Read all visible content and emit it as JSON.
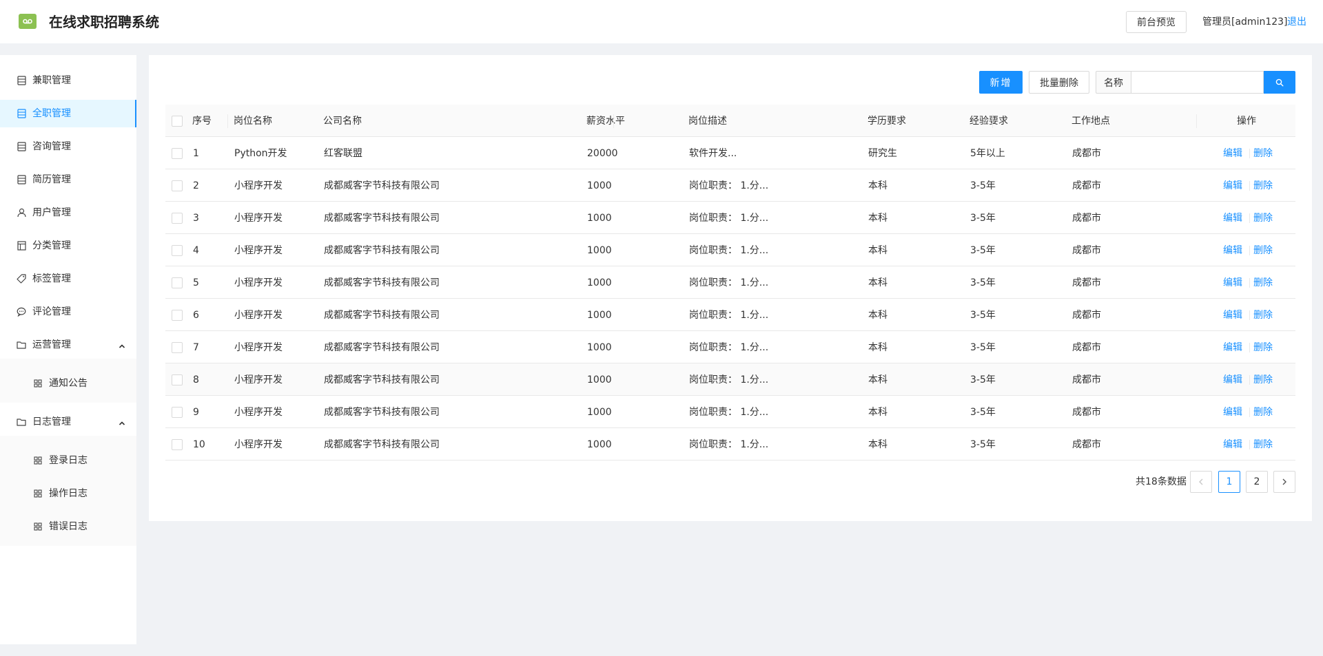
{
  "header": {
    "title": "在线求职招聘系统",
    "preview_label": "前台预览",
    "admin_label": "管理员[admin123]",
    "logout_label": "退出"
  },
  "sidebar": {
    "items": [
      {
        "label": "兼职管理",
        "icon": "list-icon"
      },
      {
        "label": "全职管理",
        "icon": "list-icon",
        "active": true
      },
      {
        "label": "咨询管理",
        "icon": "list-icon"
      },
      {
        "label": "简历管理",
        "icon": "list-icon"
      },
      {
        "label": "用户管理",
        "icon": "user-icon"
      },
      {
        "label": "分类管理",
        "icon": "layout-icon"
      },
      {
        "label": "标签管理",
        "icon": "tag-icon"
      },
      {
        "label": "评论管理",
        "icon": "comment-icon"
      },
      {
        "label": "运营管理",
        "icon": "folder-icon",
        "expanded": true,
        "children": [
          {
            "label": "通知公告",
            "icon": "grid-icon"
          }
        ]
      },
      {
        "label": "日志管理",
        "icon": "folder-icon",
        "expanded": true,
        "children": [
          {
            "label": "登录日志",
            "icon": "grid-icon"
          },
          {
            "label": "操作日志",
            "icon": "grid-icon"
          },
          {
            "label": "错误日志",
            "icon": "grid-icon"
          }
        ]
      }
    ]
  },
  "toolbar": {
    "add_label": "新增",
    "batch_delete_label": "批量删除",
    "search_addon": "名称",
    "search_value": "",
    "search_placeholder": ""
  },
  "table": {
    "columns": [
      "序号",
      "岗位名称",
      "公司名称",
      "薪资水平",
      "岗位描述",
      "学历要求",
      "经验要求",
      "工作地点",
      "操作"
    ],
    "rows": [
      [
        "1",
        "Python开发",
        "红客联盟",
        "20000",
        "软件开发...",
        "研究生",
        "5年以上",
        "成都市"
      ],
      [
        "2",
        "小程序开发",
        "成都威客字节科技有限公司",
        "1000",
        "岗位职责： 1.分...",
        "本科",
        "3-5年",
        "成都市"
      ],
      [
        "3",
        "小程序开发",
        "成都威客字节科技有限公司",
        "1000",
        "岗位职责： 1.分...",
        "本科",
        "3-5年",
        "成都市"
      ],
      [
        "4",
        "小程序开发",
        "成都威客字节科技有限公司",
        "1000",
        "岗位职责： 1.分...",
        "本科",
        "3-5年",
        "成都市"
      ],
      [
        "5",
        "小程序开发",
        "成都威客字节科技有限公司",
        "1000",
        "岗位职责： 1.分...",
        "本科",
        "3-5年",
        "成都市"
      ],
      [
        "6",
        "小程序开发",
        "成都威客字节科技有限公司",
        "1000",
        "岗位职责： 1.分...",
        "本科",
        "3-5年",
        "成都市"
      ],
      [
        "7",
        "小程序开发",
        "成都威客字节科技有限公司",
        "1000",
        "岗位职责： 1.分...",
        "本科",
        "3-5年",
        "成都市"
      ],
      [
        "8",
        "小程序开发",
        "成都威客字节科技有限公司",
        "1000",
        "岗位职责： 1.分...",
        "本科",
        "3-5年",
        "成都市"
      ],
      [
        "9",
        "小程序开发",
        "成都威客字节科技有限公司",
        "1000",
        "岗位职责： 1.分...",
        "本科",
        "3-5年",
        "成都市"
      ],
      [
        "10",
        "小程序开发",
        "成都威客字节科技有限公司",
        "1000",
        "岗位职责： 1.分...",
        "本科",
        "3-5年",
        "成都市"
      ]
    ],
    "edit_label": "编辑",
    "delete_label": "删除",
    "hover_row": 8
  },
  "pagination": {
    "total_label": "共18条数据",
    "pages": [
      "1",
      "2"
    ],
    "current": "1"
  },
  "colors": {
    "primary": "#1890ff",
    "logo": "#8cc152",
    "background": "#f0f2f5"
  }
}
